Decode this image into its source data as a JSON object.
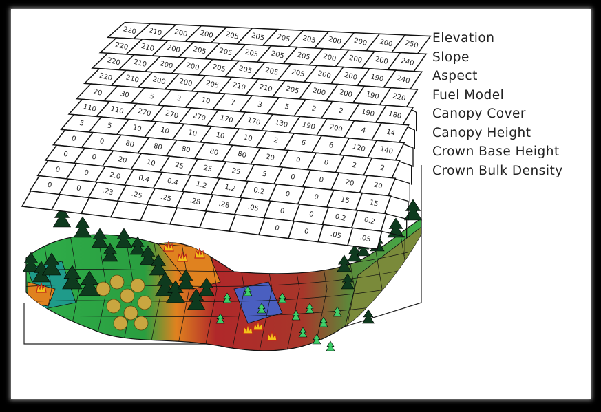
{
  "layers": [
    "Elevation",
    "Slope",
    "Aspect",
    "Fuel Model",
    "Canopy Cover",
    "Canopy Height",
    "Crown Base Height",
    "Crown Bulk Density"
  ],
  "grid_rows": [
    [
      "220",
      "210",
      "200",
      "200",
      "205",
      "205",
      "205",
      "205",
      "200",
      "200",
      "200",
      "250"
    ],
    [
      "220",
      "210",
      "200",
      "205",
      "205",
      "205",
      "205",
      "205",
      "200",
      "200",
      "200",
      "240"
    ],
    [
      "220",
      "210",
      "200",
      "200",
      "205",
      "205",
      "205",
      "205",
      "200",
      "200",
      "190",
      "240"
    ],
    [
      "220",
      "210",
      "200",
      "200",
      "205",
      "210",
      "210",
      "205",
      "200",
      "200",
      "190",
      "220"
    ],
    [
      "20",
      "30",
      "5",
      "3",
      "10",
      "7",
      "3",
      "5",
      "2",
      "2",
      "190",
      "180"
    ],
    [
      "110",
      "110",
      "270",
      "270",
      "270",
      "170",
      "170",
      "130",
      "190",
      "200",
      "4",
      "14"
    ],
    [
      "5",
      "5",
      "10",
      "10",
      "10",
      "10",
      "10",
      "2",
      "6",
      "6",
      "120",
      "140"
    ],
    [
      "0",
      "0",
      "80",
      "80",
      "80",
      "80",
      "80",
      "20",
      "0",
      "0",
      "2",
      "2"
    ],
    [
      "0",
      "0",
      "20",
      "10",
      "25",
      "25",
      "25",
      "5",
      "0",
      "0",
      "20",
      "20"
    ],
    [
      "0",
      "0",
      "2.0",
      "0.4",
      "0.4",
      "1.2",
      "1.2",
      "0.2",
      "0",
      "0",
      "15",
      "15"
    ],
    [
      "0",
      "0",
      ".23",
      ".25",
      ".25",
      ".28",
      ".28",
      ".05",
      "0",
      "0",
      "0.2",
      "0.2"
    ],
    [
      "",
      "",
      "",
      "",
      "",
      "",
      "",
      "",
      "0",
      "0",
      ".05",
      ".05"
    ]
  ],
  "colors": {
    "forest": "#2fae4a",
    "teal": "#1f9b8a",
    "burned": "#b0282a",
    "orange": "#e0821f",
    "water": "#4a5fc0",
    "rock": "#8a8a8a",
    "tree": "#0e3a1e"
  }
}
